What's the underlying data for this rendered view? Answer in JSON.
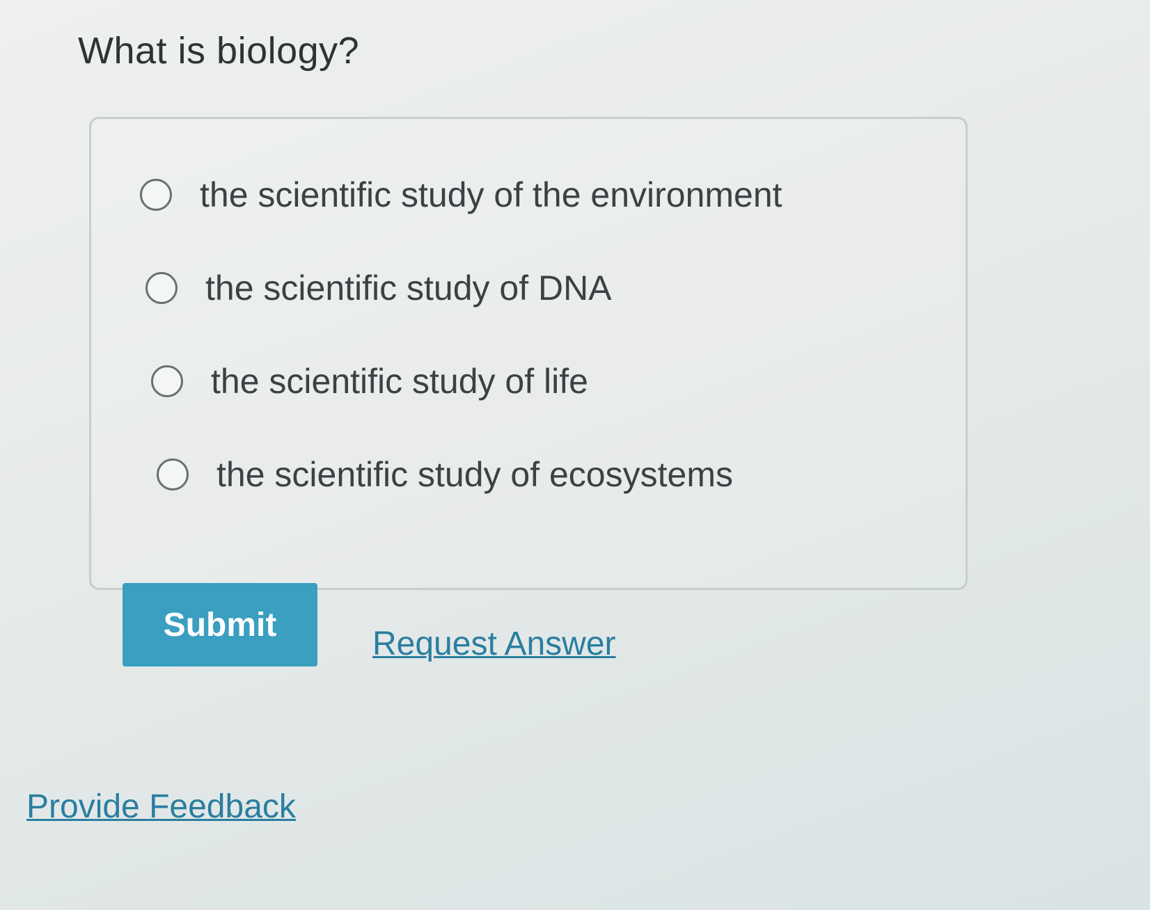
{
  "question": {
    "text": "What is biology?"
  },
  "choices": [
    {
      "label": "the scientific study of the environment",
      "selected": false
    },
    {
      "label": "the scientific study of DNA",
      "selected": false
    },
    {
      "label": "the scientific study of life",
      "selected": false
    },
    {
      "label": "the scientific study of ecosystems",
      "selected": false
    }
  ],
  "actions": {
    "submit_label": "Submit",
    "request_answer_label": "Request Answer"
  },
  "footer": {
    "feedback_label": "Provide Feedback"
  },
  "colors": {
    "accent": "#3a9fc0",
    "link": "#2a7ea0"
  }
}
